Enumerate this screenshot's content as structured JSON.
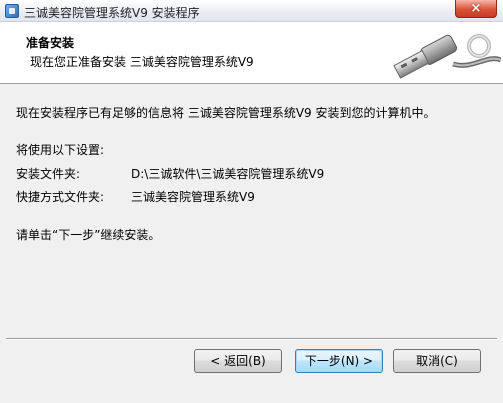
{
  "window": {
    "title": "三诚美容院管理系统V9 安装程序",
    "close_glyph": "×"
  },
  "header": {
    "title": "准备安装",
    "subtitle": "现在您正准备安装 三诚美容院管理系统V9",
    "graphic_icon": "usb-cable-icon"
  },
  "body": {
    "intro": "现在安装程序已有足够的信息将 三诚美容院管理系统V9 安装到您的计算机中。",
    "settings_heading": "将使用以下设置:",
    "settings": [
      {
        "label": "安装文件夹:",
        "value": "D:\\三诚软件\\三诚美容院管理系统V9"
      },
      {
        "label": "快捷方式文件夹:",
        "value": "三诚美容院管理系统V9"
      }
    ],
    "instruction": "请单击“下一步”继续安装。"
  },
  "buttons": {
    "back": "< 返回(B)",
    "next": "下一步(N) >",
    "cancel": "取消(C)"
  }
}
